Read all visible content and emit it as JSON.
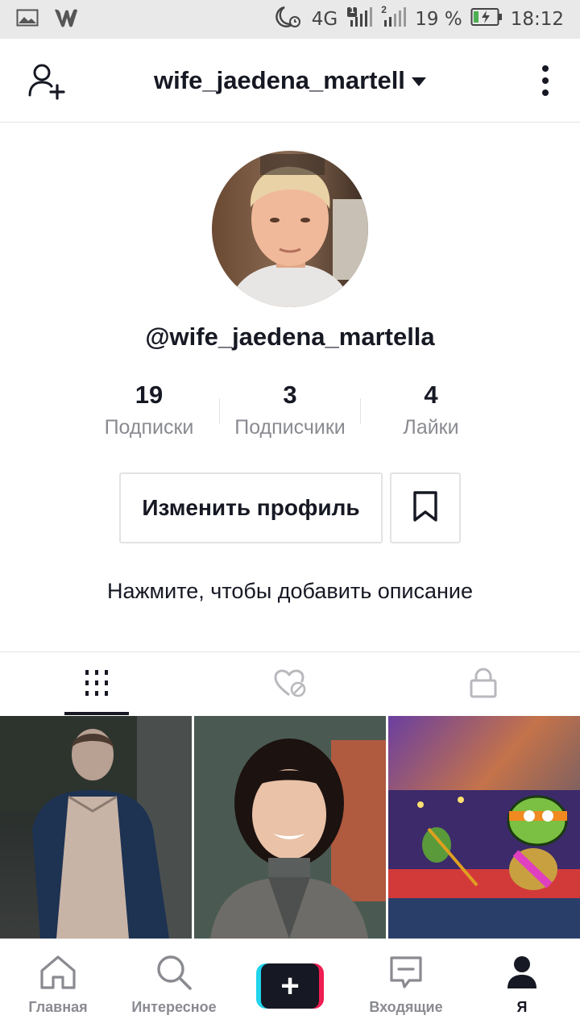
{
  "status_bar": {
    "network": "4G",
    "sim1_badge": "1",
    "sim2_badge": "2",
    "battery": "19 %",
    "time": "18:12"
  },
  "header": {
    "username": "wife_jaedena_martell",
    "icons": {
      "left": "add-user-icon",
      "right": "more-vertical-icon"
    }
  },
  "profile": {
    "handle": "@wife_jaedena_martella",
    "stats": [
      {
        "value": "19",
        "label": "Подписки"
      },
      {
        "value": "3",
        "label": "Подписчики"
      },
      {
        "value": "4",
        "label": "Лайки"
      }
    ],
    "edit_button": "Изменить профиль",
    "bio_placeholder": "Нажмите, чтобы добавить описание"
  },
  "tabs": [
    {
      "icon": "grid-icon",
      "active": true
    },
    {
      "icon": "liked-hidden-icon",
      "active": false
    },
    {
      "icon": "lock-icon",
      "active": false
    }
  ],
  "videos": [
    {
      "thumb": "girl-in-dark-jacket"
    },
    {
      "thumb": "curly-haired-boy"
    },
    {
      "thumb": "turtle-cartoon"
    }
  ],
  "bottom_nav": [
    {
      "label": "Главная",
      "icon": "home-icon"
    },
    {
      "label": "Интересное",
      "icon": "search-icon"
    },
    {
      "label": "",
      "icon": "create-plus-icon"
    },
    {
      "label": "Входящие",
      "icon": "inbox-icon"
    },
    {
      "label": "Я",
      "icon": "profile-icon",
      "active": true
    }
  ],
  "colors": {
    "text": "#161823",
    "muted": "#8a8b91",
    "divider": "#e3e3e4",
    "cyan": "#20d5ec",
    "pink": "#ee1d52"
  }
}
